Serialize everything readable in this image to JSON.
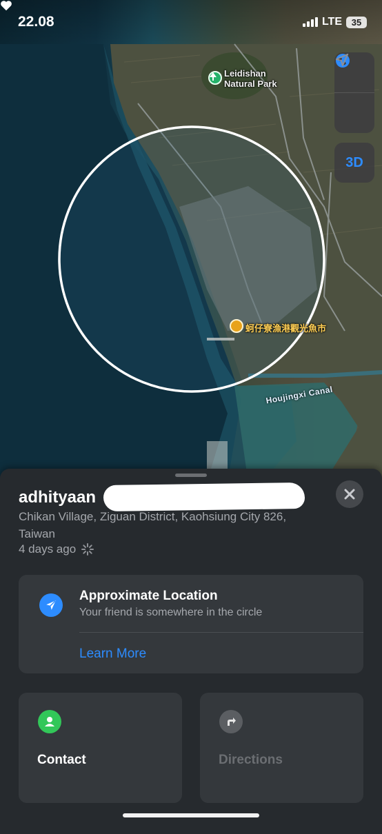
{
  "status_bar": {
    "time": "22.08",
    "network": "LTE",
    "battery": "35"
  },
  "map": {
    "poi_park": "Leidishan\nNatural Park",
    "poi_market": "蚵仔寮漁港觀光魚市",
    "canal": "Houjingxi Canal",
    "view_3d": "3D"
  },
  "sheet": {
    "name": "adhityaan",
    "address": "Chikan Village, Ziguan District, Kaohsiung City 826, Taiwan",
    "updated": "4 days ago",
    "approx": {
      "title": "Approximate Location",
      "subtitle": "Your friend is somewhere in the circle",
      "link": "Learn More"
    },
    "actions": {
      "contact": "Contact",
      "directions": "Directions"
    }
  },
  "colors": {
    "accent": "#2d8cff",
    "contact_green": "#32c759",
    "sheet_bg": "#262a2e",
    "card_bg": "#34383c"
  },
  "icons": [
    "heart-icon",
    "signal-icon",
    "battery-icon",
    "globe-icon",
    "location-arrow-icon",
    "park-icon",
    "market-icon",
    "close-icon",
    "spinner-icon",
    "airplane-icon",
    "person-icon",
    "directions-arrow-icon"
  ]
}
